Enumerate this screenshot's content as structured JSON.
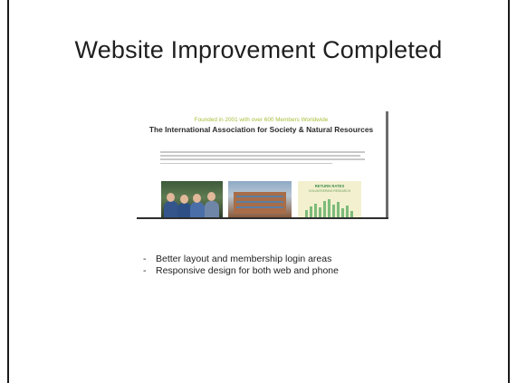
{
  "slide": {
    "title": "Website Improvement Completed",
    "bullets": [
      "Better layout and membership login areas",
      "Responsive design for both web and phone"
    ]
  },
  "screenshot": {
    "tagline": "Founded in 2001 with over 600 Members Worldwide",
    "org_name": "The International Association for Society & Natural Resources",
    "promo_title": "RETURN RATES",
    "promo_subtitle": "VOLUNTEERING RESEARCH",
    "colors": {
      "tagline": "#a9bd3c",
      "promo_background": "#f3f0cf",
      "promo_bars": "#7dbb7a"
    }
  }
}
